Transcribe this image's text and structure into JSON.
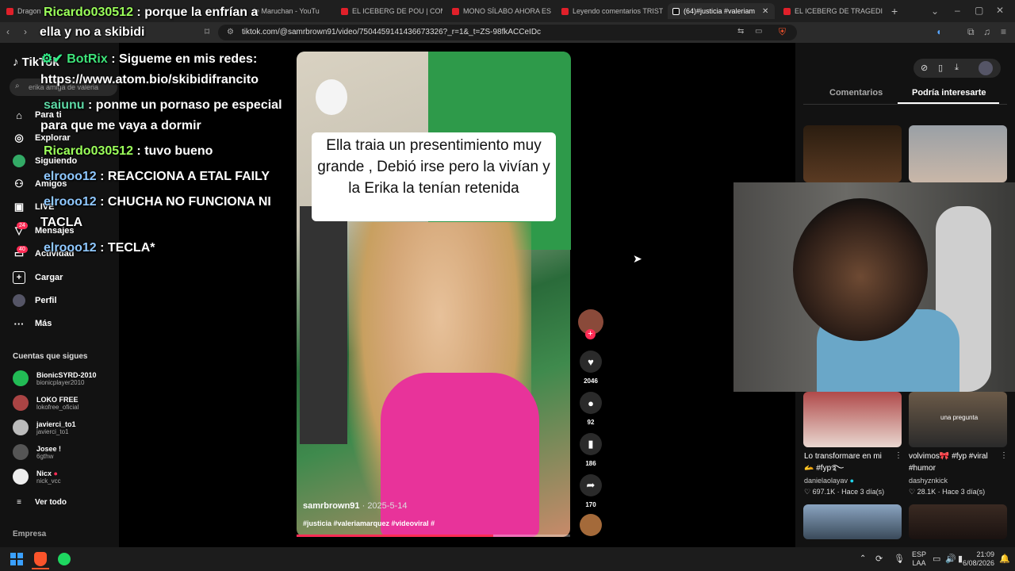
{
  "browser": {
    "tabs": [
      {
        "label": "Dragon"
      },
      {
        "label": "ie Maruchan - YouTu"
      },
      {
        "label": "EL ICEBERG DE POU | COMPL"
      },
      {
        "label": "MONO SÍLABO AHORA ES BA"
      },
      {
        "label": "Leyendo comentarios TRISTES"
      },
      {
        "label": "(64)#justicia #valeriam"
      },
      {
        "label": "EL ICEBERG DE TRAGEDIAS EN"
      }
    ],
    "new_tab": "+",
    "url": "tiktok.com/@samrbrown91/video/7504459141436673326?_r=1&_t=ZS-98fkACCeIDc"
  },
  "sidebar": {
    "logo": "TikTok",
    "search_placeholder": "erika amiga de valeria",
    "nav": [
      {
        "label": "Para ti",
        "icon": "home-icon"
      },
      {
        "label": "Explorar",
        "icon": "compass-icon"
      },
      {
        "label": "Siguiendo",
        "icon": "following-icon"
      },
      {
        "label": "Amigos",
        "icon": "friends-icon"
      },
      {
        "label": "LIVE",
        "icon": "live-icon"
      },
      {
        "label": "Mensajes",
        "icon": "messages-icon",
        "badge": "24"
      },
      {
        "label": "Actividad",
        "icon": "activity-icon",
        "badge": "40"
      },
      {
        "label": "Cargar",
        "icon": "upload-icon"
      },
      {
        "label": "Perfil",
        "icon": "profile-icon"
      },
      {
        "label": "Más",
        "icon": "more-icon"
      }
    ],
    "following_title": "Cuentas que sigues",
    "following": [
      {
        "name": "BionicSYRD-2010",
        "handle": "bionicplayer2010"
      },
      {
        "name": "LOKO FREE",
        "handle": "lokofree_oficial"
      },
      {
        "name": "javierci_to1",
        "handle": "javierci_to1"
      },
      {
        "name": "Josee !",
        "handle": "6gthw"
      },
      {
        "name": "Nicx",
        "handle": "nick_vcc"
      }
    ],
    "see_all": "Ver todo",
    "company": "Empresa"
  },
  "chat": [
    {
      "user": "Ricardo030512",
      "msg": ": porque la enfrían a",
      "cont": "ella y no a skibidi"
    },
    {
      "user": "BotRix",
      "msg": ": Sigueme en mis redes:",
      "cont": "https://www.atom.bio/skibidifrancito"
    },
    {
      "user": "saiunu",
      "msg": ": ponme un pornaso pe especial",
      "cont": "para que me vaya a dormir"
    },
    {
      "user": "Ricardo030512",
      "msg": ": tuvo bueno"
    },
    {
      "user": "elrooo12",
      "msg": ": REACCIONA A ETAL FAILY"
    },
    {
      "user": "elrooo12",
      "msg": ": CHUCHA NO FUNCIONA NI",
      "cont": "TACLA"
    },
    {
      "user": "elrooo12",
      "msg": ": TECLA*"
    }
  ],
  "video": {
    "caption": "Ella traia un presentimiento muy grande , Debió irse pero la vivían y la Erika la tenían retenida",
    "author": "samrbrown91",
    "date": "· 2025-5-14",
    "tags": "#justicia #valeriamarquez #videoviral #",
    "progress": 0.72
  },
  "actions": {
    "likes": "2046",
    "comments": "92",
    "saves": "186",
    "shares": "170"
  },
  "right_panel": {
    "tabs": [
      "Comentarios",
      "Podría interesarte"
    ],
    "cards": [
      {
        "title": "Lo transformare en mi",
        "title2": "🫴 #fyp࿐",
        "user": "danielaolayav",
        "views": "697.1K",
        "time": "Hace 3 día(s)"
      },
      {
        "title": "volvimos🎀 #fyp #viral",
        "title2": "#humor",
        "user": "dashyznkick",
        "views": "28.1K",
        "time": "Hace 3 día(s)",
        "overlay": "una pregunta"
      }
    ]
  },
  "taskbar": {
    "lang1": "ESP",
    "lang2": "LAA",
    "time": "21:09",
    "date": "6/08/2026"
  },
  "colors": {
    "accent": "#fe2c55",
    "bg": "#121212"
  }
}
